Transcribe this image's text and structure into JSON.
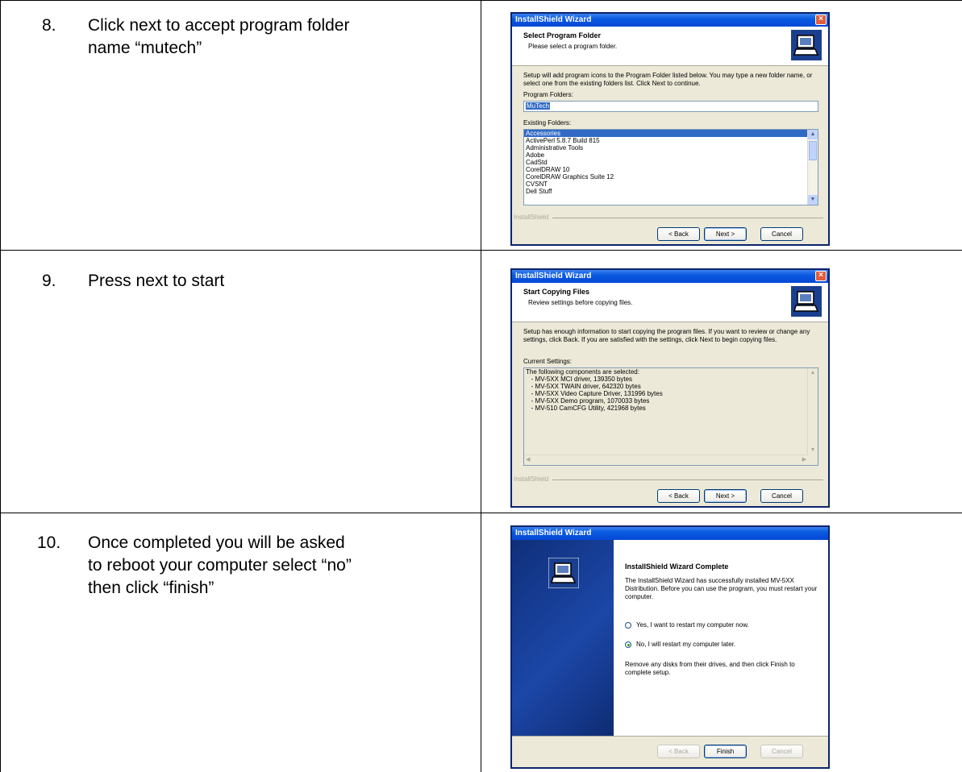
{
  "steps": [
    {
      "number": "8.",
      "text": "Click next to accept program folder name “mutech”",
      "dialog": {
        "title": "InstallShield Wizard",
        "close_icon": "close-icon",
        "header_title": "Select Program Folder",
        "header_subtitle": "Please select a program folder.",
        "description": "Setup will add program icons to the Program Folder listed below. You may type a new folder name, or select one from the existing folders list. Click Next to continue.",
        "program_folders_label": "Program Folders:",
        "program_folder_value": "MuTech",
        "existing_folders_label": "Existing Folders:",
        "existing_folders": [
          "Accessories",
          "ActivePerl 5.8.7 Build 815",
          "Administrative Tools",
          "Adobe",
          "CadStd",
          "CorelDRAW 10",
          "CorelDRAW Graphics Suite 12",
          "CVSNT",
          "Dell Stuff"
        ],
        "brand": "InstallShield",
        "back_label": "< Back",
        "next_label": "Next >",
        "cancel_label": "Cancel"
      }
    },
    {
      "number": "9.",
      "text": "Press next to start",
      "dialog": {
        "title": "InstallShield Wizard",
        "header_title": "Start Copying Files",
        "header_subtitle": "Review settings before copying files.",
        "description": "Setup has enough information to start copying the program files. If you want to review or change any settings, click Back. If you are satisfied with the settings, click Next to begin copying files.",
        "current_settings_label": "Current Settings:",
        "settings_lines": [
          "The following components are selected:",
          "   - MV-5XX MCI driver, 139350 bytes",
          "   - MV-5XX TWAIN driver, 642320 bytes",
          "   - MV-5XX Video Capture Driver, 131996 bytes",
          "   - MV-5XX Demo program, 1070033 bytes",
          "   - MV-510 CamCFG Utility, 421968 bytes"
        ],
        "brand": "InstallShield",
        "back_label": "< Back",
        "next_label": "Next >",
        "cancel_label": "Cancel"
      }
    },
    {
      "number": "10.",
      "text": "Once completed you will be asked to reboot your computer select “no” then click “finish”",
      "dialog": {
        "title": "InstallShield Wizard",
        "heading": "InstallShield Wizard Complete",
        "description": "The InstallShield Wizard has successfully installed MV-5XX Distribution. Before you can use the program, you must restart your computer.",
        "radio_yes": "Yes, I want to restart my computer now.",
        "radio_no": "No, I will restart my computer later.",
        "selected_option": "no",
        "footer": "Remove any disks from their drives, and then click Finish to complete setup.",
        "back_label": "< Back",
        "finish_label": "Finish",
        "cancel_label": "Cancel"
      }
    }
  ],
  "colors": {
    "title_bar": "#0a5ae0",
    "selection": "#316ac5",
    "dialog_bg": "#ece9d8"
  }
}
